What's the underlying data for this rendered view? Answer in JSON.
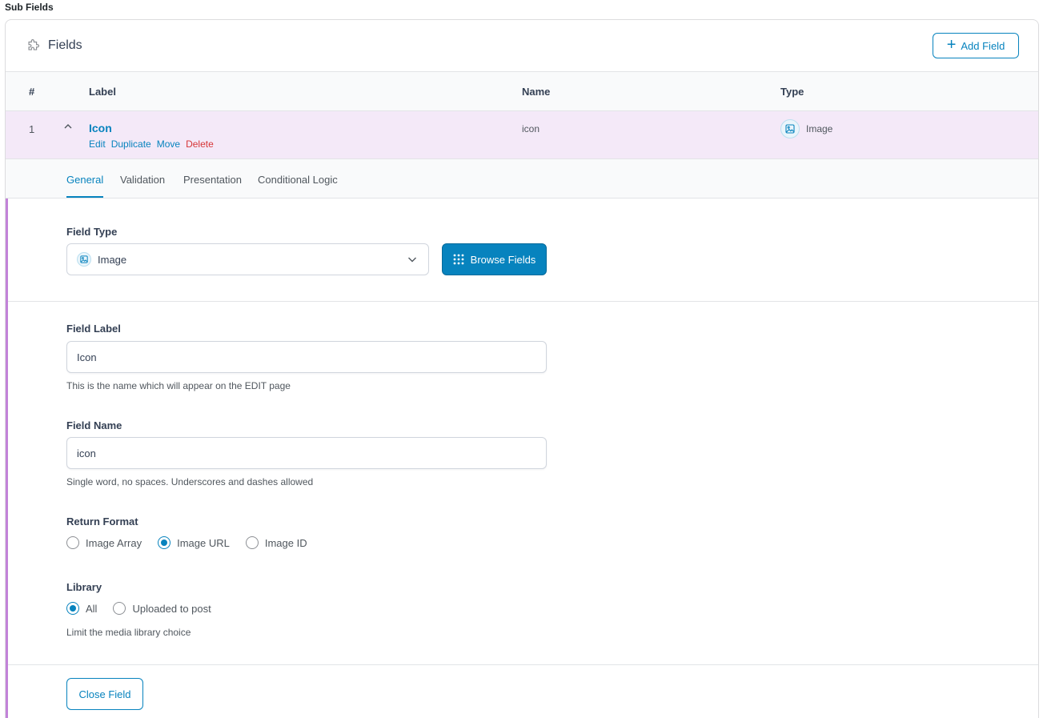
{
  "section_title": "Sub Fields",
  "panel": {
    "title": "Fields",
    "add_field_label": "Add Field"
  },
  "table": {
    "headers": {
      "num": "#",
      "label": "Label",
      "name": "Name",
      "type": "Type"
    }
  },
  "field": {
    "number": "1",
    "label": "Icon",
    "actions": {
      "edit": "Edit",
      "duplicate": "Duplicate",
      "move": "Move",
      "delete": "Delete"
    },
    "name": "icon",
    "type": "Image"
  },
  "tabs": [
    {
      "label": "General",
      "active": true
    },
    {
      "label": "Validation",
      "active": false
    },
    {
      "label": "Presentation",
      "active": false
    },
    {
      "label": "Conditional Logic",
      "active": false
    }
  ],
  "settings": {
    "field_type": {
      "label": "Field Type",
      "value": "Image",
      "browse_label": "Browse Fields"
    },
    "field_label": {
      "label": "Field Label",
      "value": "Icon",
      "hint": "This is the name which will appear on the EDIT page"
    },
    "field_name": {
      "label": "Field Name",
      "value": "icon",
      "hint": "Single word, no spaces. Underscores and dashes allowed"
    },
    "return_format": {
      "label": "Return Format",
      "options": [
        "Image Array",
        "Image URL",
        "Image ID"
      ],
      "selected": "Image URL"
    },
    "library": {
      "label": "Library",
      "options": [
        "All",
        "Uploaded to post"
      ],
      "selected": "All",
      "hint": "Limit the media library choice"
    },
    "close_label": "Close Field"
  },
  "colors": {
    "accent": "#0783be",
    "row_highlight": "#f4e9f8",
    "left_bar": "#c283d8",
    "delete": "#d63638"
  }
}
